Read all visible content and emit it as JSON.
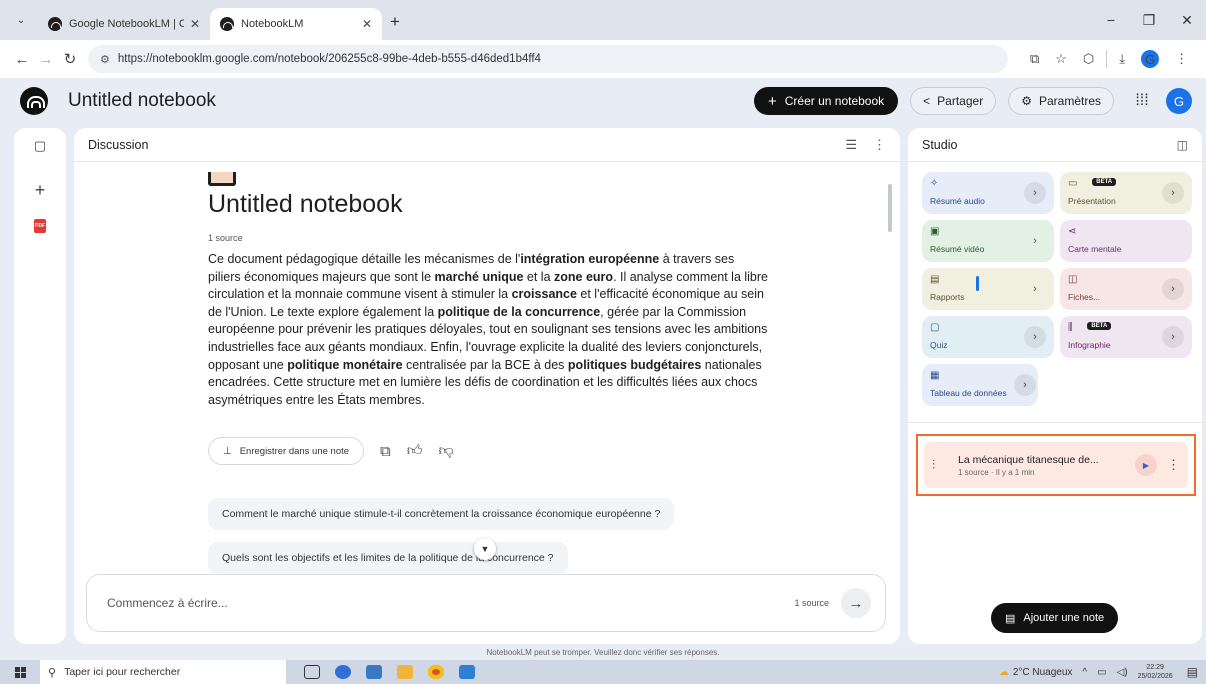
{
  "browser": {
    "tabs": [
      {
        "title": "Google NotebookLM | Outil de",
        "active": false
      },
      {
        "title": "NotebookLM",
        "active": true
      }
    ],
    "url": "https://notebooklm.google.com/notebook/206255c8-99be-4deb-b555-d46ded1b4ff4",
    "profile_initial": "G"
  },
  "app": {
    "title": "Untitled notebook",
    "create_label": "Créer un notebook",
    "share_label": "Partager",
    "settings_label": "Paramètres",
    "avatar_initial": "G"
  },
  "discussion": {
    "header": "Discussion",
    "notebook_title": "Untitled notebook",
    "source_count": "1 source",
    "summary": [
      {
        "t": "Ce document pédagogique détaille les mécanismes de l'"
      },
      {
        "t": "intégration européenne",
        "b": true
      },
      {
        "t": " à travers ses piliers économiques majeurs que sont le "
      },
      {
        "t": "marché unique",
        "b": true
      },
      {
        "t": " et la "
      },
      {
        "t": "zone euro",
        "b": true
      },
      {
        "t": ". Il analyse comment la libre circulation et la monnaie commune visent à stimuler la "
      },
      {
        "t": "croissance",
        "b": true
      },
      {
        "t": " et l'efficacité économique au sein de l'Union. Le texte explore également la "
      },
      {
        "t": "politique de la concurrence",
        "b": true
      },
      {
        "t": ", gérée par la Commission européenne pour prévenir les pratiques déloyales, tout en soulignant ses tensions avec les ambitions industrielles face aux géants mondiaux. Enfin, l'ouvrage explicite la dualité des leviers conjoncturels, opposant une "
      },
      {
        "t": "politique monétaire",
        "b": true
      },
      {
        "t": " centralisée par la BCE à des "
      },
      {
        "t": "politiques budgétaires",
        "b": true
      },
      {
        "t": " nationales encadrées. Cette structure met en lumière les défis de coordination et les difficultés liées aux chocs asymétriques entre les États membres."
      }
    ],
    "save_note_label": "Enregistrer dans une note",
    "suggestions": [
      "Comment le marché unique stimule-t-il concrètement la croissance économique européenne ?",
      "Quels sont les objectifs et les limites de la politique de la concurrence ?"
    ],
    "composer_placeholder": "Commencez à écrire...",
    "composer_source_count": "1 source"
  },
  "studio": {
    "header": "Studio",
    "cards": [
      {
        "label": "Résumé audio",
        "color": "blue",
        "icon": "audio-sparkle-icon",
        "beta": false
      },
      {
        "label": "Présentation",
        "color": "yellow",
        "icon": "slides-icon",
        "beta": true
      },
      {
        "label": "Résumé vidéo",
        "color": "green",
        "icon": "video-icon",
        "beta": false
      },
      {
        "label": "Carte mentale",
        "color": "purple",
        "icon": "mindmap-icon",
        "beta": false
      },
      {
        "label": "Rapports",
        "color": "yellow",
        "icon": "report-icon",
        "beta": false
      },
      {
        "label": "Fiches...",
        "color": "pink",
        "icon": "flashcards-icon",
        "beta": false
      },
      {
        "label": "Quiz",
        "color": "teal",
        "icon": "quiz-icon",
        "beta": false
      },
      {
        "label": "Infographie",
        "color": "purple",
        "icon": "infographic-icon",
        "beta": true
      },
      {
        "label": "Tableau de données",
        "color": "blue",
        "icon": "table-icon",
        "beta": false
      }
    ],
    "beta_label": "BÊTA",
    "audio_item": {
      "title": "La mécanique titanesque de...",
      "meta": "1 source · Il y a 1 min"
    },
    "add_note_label": "Ajouter une note",
    "accent_color": "#f26a2c"
  },
  "disclaimer": "NotebookLM peut se tromper. Veuillez donc vérifier ses réponses.",
  "taskbar": {
    "search_placeholder": "Taper ici pour rechercher",
    "weather": "2°C Nuageux",
    "time": "22:29",
    "date": "25/02/2026"
  }
}
